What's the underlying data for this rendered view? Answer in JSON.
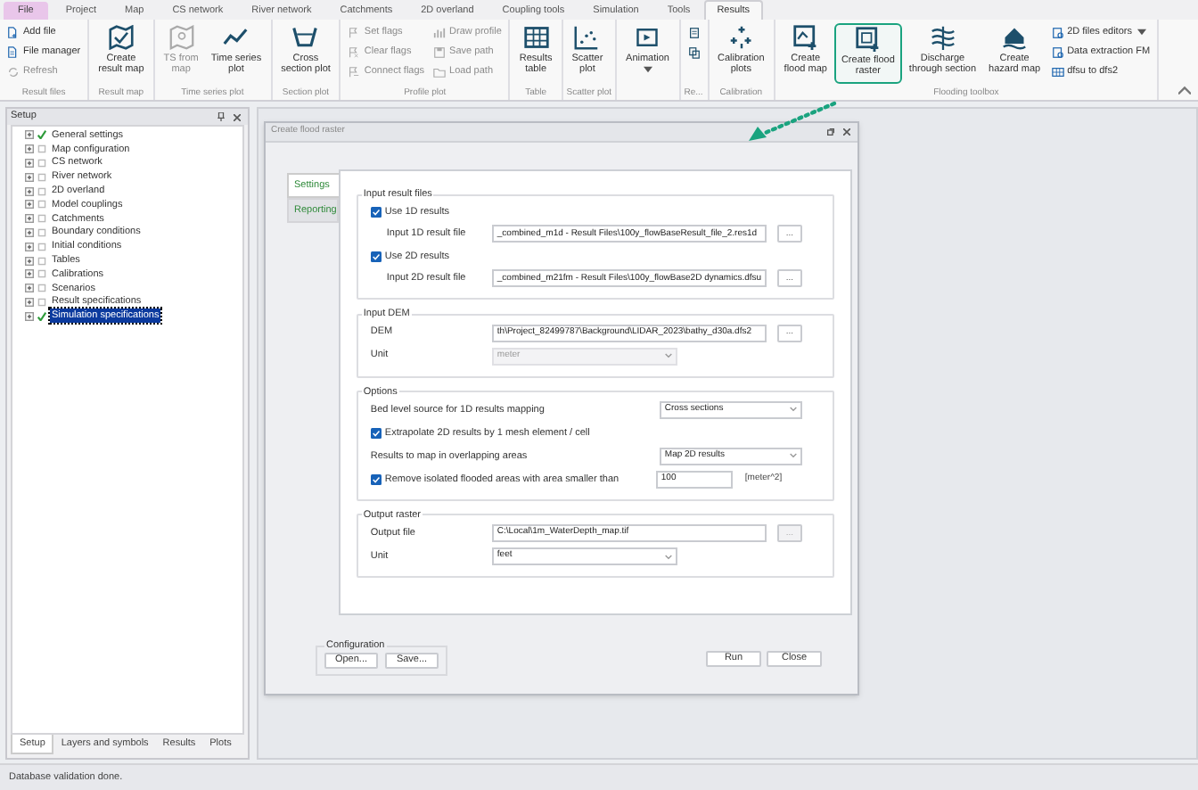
{
  "menu_tabs": [
    {
      "label": "File",
      "kind": "file",
      "selected": false
    },
    {
      "label": "Project",
      "kind": "tab",
      "selected": false
    },
    {
      "label": "Map",
      "kind": "tab",
      "selected": false
    },
    {
      "label": "CS network",
      "kind": "tab",
      "selected": false
    },
    {
      "label": "River network",
      "kind": "tab",
      "selected": false
    },
    {
      "label": "Catchments",
      "kind": "tab",
      "selected": false
    },
    {
      "label": "2D overland",
      "kind": "tab",
      "selected": false
    },
    {
      "label": "Coupling tools",
      "kind": "tab",
      "selected": false
    },
    {
      "label": "Simulation",
      "kind": "tab",
      "selected": false
    },
    {
      "label": "Tools",
      "kind": "tab",
      "selected": false
    },
    {
      "label": "Results",
      "kind": "tab",
      "selected": true
    }
  ],
  "ribbon_groups": [
    {
      "label": "Result files",
      "items": [
        {
          "kind": "small",
          "label": "Add file",
          "disabled": false
        },
        {
          "kind": "small",
          "label": "File manager",
          "disabled": false
        },
        {
          "kind": "small",
          "label": "Refresh",
          "disabled": true
        }
      ]
    },
    {
      "label": "Result map",
      "items": [
        {
          "kind": "large",
          "label": "Create\nresult map",
          "disabled": false
        }
      ]
    },
    {
      "label": "Time series plot",
      "items": [
        {
          "kind": "large",
          "label": "TS from\nmap",
          "disabled": true
        },
        {
          "kind": "large",
          "label": "Time series\nplot",
          "disabled": false
        }
      ]
    },
    {
      "label": "Section plot",
      "items": [
        {
          "kind": "large",
          "label": "Cross\nsection plot",
          "disabled": false
        }
      ]
    },
    {
      "label": "Profile plot",
      "items": [
        {
          "kind": "small",
          "label": "Set flags",
          "disabled": true
        },
        {
          "kind": "small",
          "label": "Clear flags",
          "disabled": true
        },
        {
          "kind": "small",
          "label": "Connect flags",
          "disabled": true
        },
        {
          "kind": "small",
          "label": "Draw profile",
          "disabled": true
        },
        {
          "kind": "small",
          "label": "Save path",
          "disabled": true
        },
        {
          "kind": "small",
          "label": "Load path",
          "disabled": true
        }
      ]
    },
    {
      "label": "Table",
      "items": [
        {
          "kind": "large",
          "label": "Results\ntable",
          "disabled": false
        }
      ]
    },
    {
      "label": "Scatter plot",
      "items": [
        {
          "kind": "large",
          "label": "Scatter\nplot",
          "disabled": false
        }
      ]
    },
    {
      "items": [
        {
          "kind": "large",
          "label": "Animation",
          "disabled": false,
          "has_menu": true
        }
      ]
    },
    {
      "label": "Re...",
      "items": [
        {
          "kind": "small",
          "disabled": false
        },
        {
          "kind": "small",
          "disabled": false
        }
      ]
    },
    {
      "label": "Calibration",
      "items": [
        {
          "kind": "large",
          "label": "Calibration\nplots",
          "disabled": false
        }
      ]
    },
    {
      "label": "Flooding toolbox",
      "items": [
        {
          "kind": "large",
          "label": "Create\nflood map",
          "disabled": false
        },
        {
          "kind": "large",
          "label": "Create flood\nraster",
          "disabled": false,
          "highlighted": true
        },
        {
          "kind": "large",
          "label": "Discharge\nthrough section",
          "disabled": false
        },
        {
          "kind": "large",
          "label": "Create\nhazard map",
          "disabled": false
        },
        {
          "kind": "small",
          "label": "2D files editors",
          "disabled": false,
          "has_menu": true
        },
        {
          "kind": "small",
          "label": "Data extraction FM",
          "disabled": false
        },
        {
          "kind": "small",
          "label": "dfsu to dfs2",
          "disabled": false
        }
      ]
    }
  ],
  "setup_panel": {
    "title": "Setup",
    "items": [
      {
        "label": "General settings",
        "checked": true,
        "selected": false
      },
      {
        "label": "Map configuration",
        "checked": false,
        "selected": false
      },
      {
        "label": "CS network",
        "checked": false,
        "selected": false
      },
      {
        "label": "River network",
        "checked": false,
        "selected": false
      },
      {
        "label": "2D overland",
        "checked": false,
        "selected": false
      },
      {
        "label": "Model couplings",
        "checked": false,
        "selected": false
      },
      {
        "label": "Catchments",
        "checked": false,
        "selected": false
      },
      {
        "label": "Boundary conditions",
        "checked": false,
        "selected": false
      },
      {
        "label": "Initial conditions",
        "checked": false,
        "selected": false
      },
      {
        "label": "Tables",
        "checked": false,
        "selected": false
      },
      {
        "label": "Calibrations",
        "checked": false,
        "selected": false
      },
      {
        "label": "Scenarios",
        "checked": false,
        "selected": false
      },
      {
        "label": "Result specifications",
        "checked": false,
        "selected": false
      },
      {
        "label": "Simulation specifications",
        "checked": true,
        "selected": true
      }
    ],
    "tabs": [
      {
        "label": "Setup",
        "selected": true
      },
      {
        "label": "Layers and symbols",
        "selected": false
      },
      {
        "label": "Results",
        "selected": false
      },
      {
        "label": "Plots",
        "selected": false
      }
    ]
  },
  "dialog": {
    "title": "Create flood raster",
    "tabs": [
      {
        "label": "Settings",
        "selected": true
      },
      {
        "label": "Reporting",
        "selected": false
      }
    ],
    "sections": [
      {
        "title": "Input result files",
        "kind": "form",
        "rows": [
          {
            "kind": "checkbox",
            "label": "Use 1D results",
            "checked": true,
            "children": [
              {
                "kind": "file",
                "label": "Input 1D result file",
                "value": "_combined_m1d - Result Files\\100y_flowBaseResult_file_2.res1d",
                "button": "...",
                "button_disabled": false
              }
            ]
          },
          {
            "kind": "checkbox",
            "label": "Use 2D results",
            "checked": true,
            "children": [
              {
                "kind": "file",
                "label": "Input 2D result file",
                "value": "_combined_m21fm - Result Files\\100y_flowBase2D dynamics.dfsu",
                "button": "...",
                "button_disabled": false
              }
            ]
          }
        ]
      },
      {
        "title": "Input DEM",
        "kind": "form",
        "rows": [
          {
            "kind": "file",
            "label": "DEM",
            "value": "th\\Project_82499787\\Background\\LIDAR_2023\\bathy_d30a.dfs2",
            "button": "...",
            "button_disabled": false
          },
          {
            "kind": "select",
            "label": "Unit",
            "value": "meter",
            "disabled": true
          }
        ]
      },
      {
        "title": "Options",
        "kind": "options",
        "rows": [
          {
            "kind": "select",
            "label": "Bed level source for 1D results mapping",
            "value": "Cross sections",
            "disabled": false
          },
          {
            "kind": "checkbox",
            "label": "Extrapolate 2D results by 1 mesh element / cell",
            "checked": true
          },
          {
            "kind": "select",
            "label": "Results to map in overlapping areas",
            "value": "Map 2D results",
            "disabled": false
          },
          {
            "kind": "checkbox_input",
            "label": "Remove isolated flooded areas with area smaller than",
            "checked": true,
            "value": "100",
            "unit": "[meter^2]"
          }
        ]
      },
      {
        "title": "Output raster",
        "kind": "form",
        "rows": [
          {
            "kind": "file",
            "label": "Output file",
            "value": "C:\\Local\\1m_WaterDepth_map.tif",
            "button": "...",
            "button_disabled": true
          },
          {
            "kind": "select",
            "label": "Unit",
            "value": "feet",
            "disabled": false
          }
        ]
      }
    ],
    "configuration": {
      "title": "Configuration",
      "buttons": [
        "Open...",
        "Save..."
      ]
    },
    "actions": [
      "Run",
      "Close"
    ]
  },
  "status_bar": "Database validation done."
}
